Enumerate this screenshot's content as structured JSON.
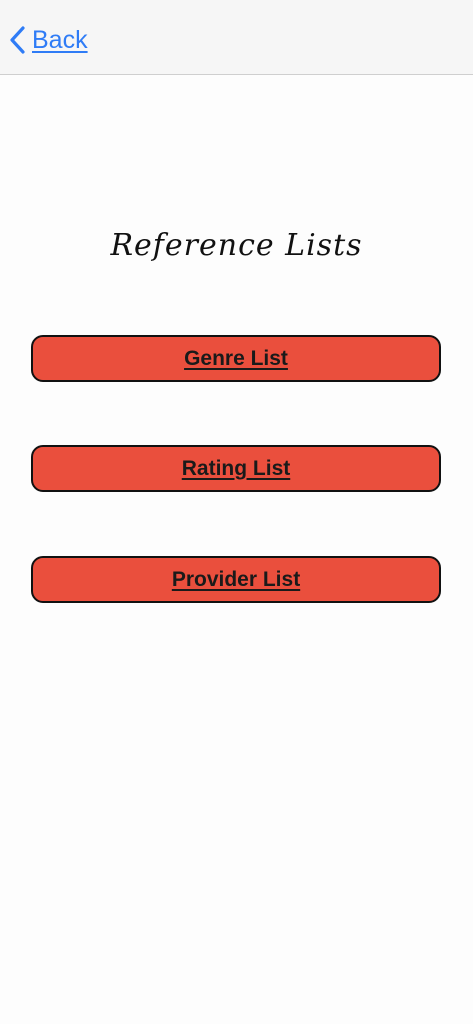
{
  "nav": {
    "back_label": "Back",
    "accent": "#2f7cf6"
  },
  "page": {
    "title": "Reference Lists"
  },
  "buttons": [
    {
      "label": "Genre List"
    },
    {
      "label": "Rating List"
    },
    {
      "label": "Provider List"
    }
  ],
  "colors": {
    "button_fill": "#ea4f3d",
    "button_border": "#111111",
    "nav_background": "#f6f6f6"
  }
}
